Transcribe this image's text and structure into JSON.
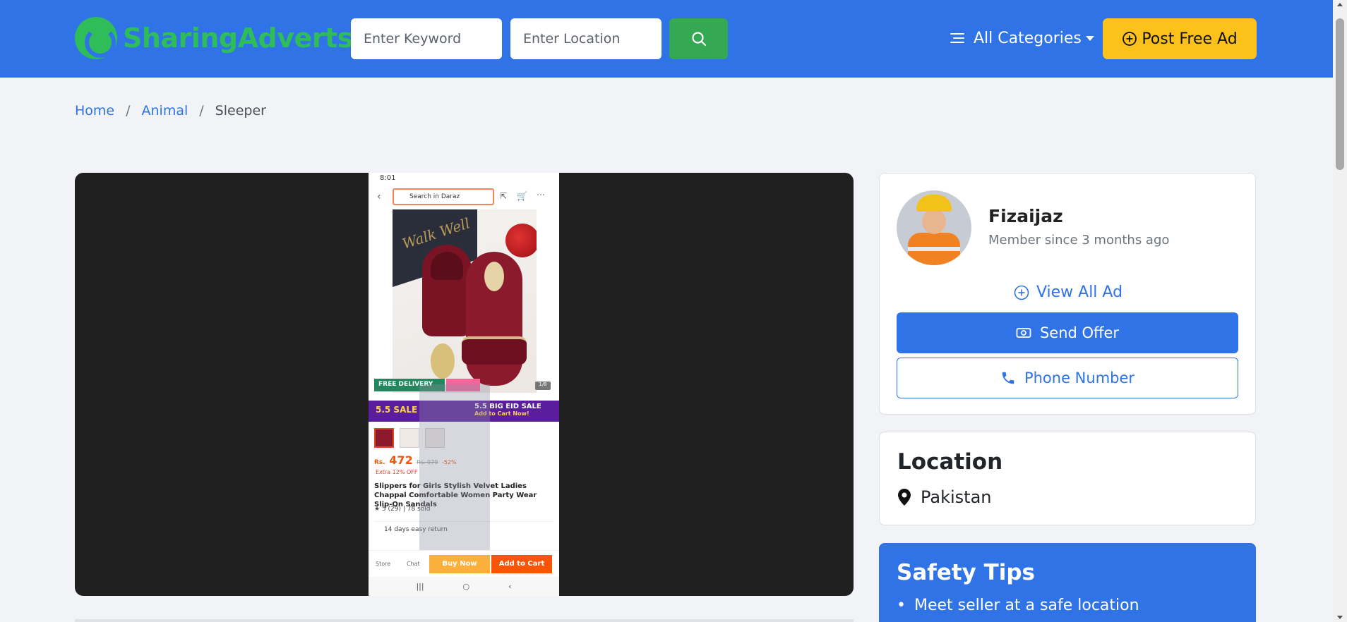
{
  "header": {
    "logo_part1": "Sharing",
    "logo_part2": "Adverts",
    "keyword_placeholder": "Enter Keyword",
    "location_placeholder": "Enter Location",
    "categories_label": "All Categories",
    "post_ad_label": "Post Free Ad",
    "colors": {
      "bar": "#2f73e6",
      "logo": "#2ebd59",
      "search_button": "#34a853",
      "post_ad": "#fdc11c"
    }
  },
  "breadcrumb": {
    "items": [
      "Home",
      "Animal"
    ],
    "current": "Sleeper"
  },
  "gallery": {
    "screenshot": {
      "time": "8:01",
      "search_placeholder": "Search in Daraz",
      "brand_on_box": "Walk Well",
      "delivery_badge": "FREE DELIVERY",
      "image_counter": "1/8",
      "sale_left": "5.5 SALE",
      "sale_right_line1": "5.5 BIG EID SALE",
      "sale_right_line2": "Add to Cart Now!",
      "price_currency": "Rs.",
      "price_value": "472",
      "old_price": "Rs. 979",
      "discount": "-52%",
      "extra_off": "Extra 12% OFF",
      "title": "Slippers for Girls Stylish Velvet Ladies Chappal Comfortable Women Party Wear Slip-On Sandals",
      "rating": "5 (29)",
      "sold": "78 sold",
      "returns": "14 days easy return",
      "store_label": "Store",
      "chat_label": "Chat",
      "buy_now": "Buy Now",
      "add_to_cart": "Add to Cart"
    }
  },
  "seller": {
    "name": "Fizaijaz",
    "member_since": "Member since 3 months ago",
    "view_all_label": "View All Ad",
    "send_offer_label": "Send Offer",
    "phone_label": "Phone Number"
  },
  "location": {
    "title": "Location",
    "value": "Pakistan"
  },
  "safety": {
    "title": "Safety Tips",
    "tips": [
      "Meet seller at a safe location"
    ]
  }
}
